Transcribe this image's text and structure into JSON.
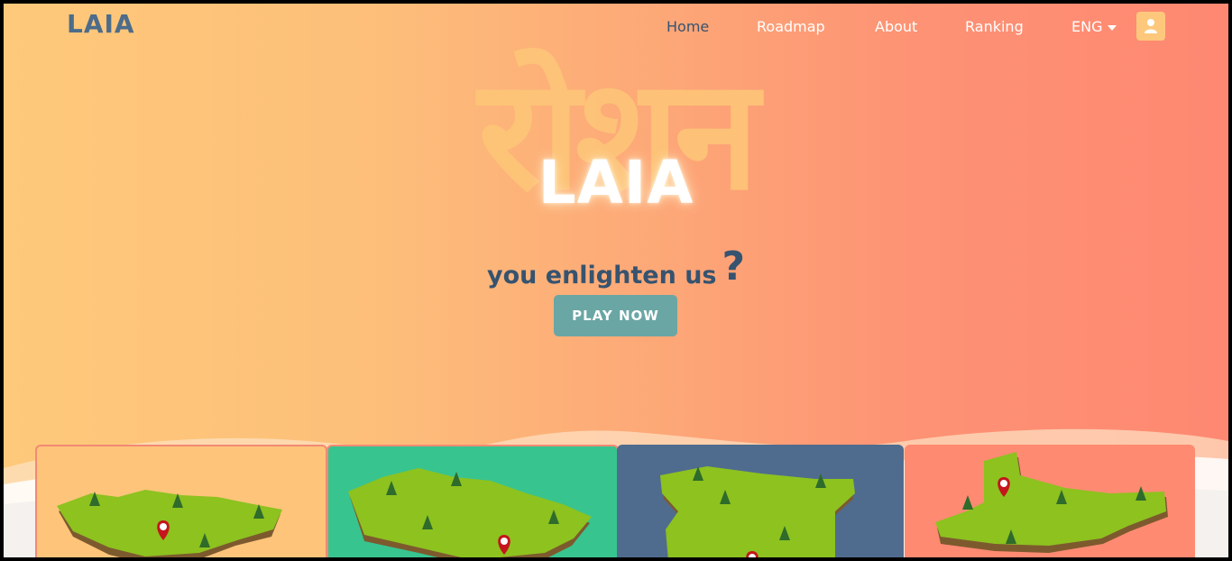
{
  "brand": {
    "logo": "LAIA"
  },
  "nav": {
    "items": [
      {
        "label": "Home",
        "active": true
      },
      {
        "label": "Roadmap",
        "active": false
      },
      {
        "label": "About",
        "active": false
      },
      {
        "label": "Ranking",
        "active": false
      }
    ],
    "language": "ENG",
    "icons": {
      "language_toggle": "caret-down-icon",
      "user": "user-icon"
    }
  },
  "hero": {
    "background_script": "रोशन",
    "title": "LAIA",
    "tagline": "you enlighten us",
    "tagline_mark": "?",
    "cta_label": "PLAY NOW"
  },
  "cards": [
    {
      "name": "map-card-1",
      "color": "#fec47a"
    },
    {
      "name": "map-card-2",
      "color": "#38c48f"
    },
    {
      "name": "map-card-3",
      "color": "#4f6c8e"
    },
    {
      "name": "map-card-4",
      "color": "#fe8a72"
    }
  ],
  "colors": {
    "brand_dark": "#36536f",
    "cta": "#6aa6a4",
    "gradient_start": "#fec97a",
    "gradient_end": "#fe8872",
    "map_green": "#8dc21f",
    "map_pin": "#c4161c"
  }
}
